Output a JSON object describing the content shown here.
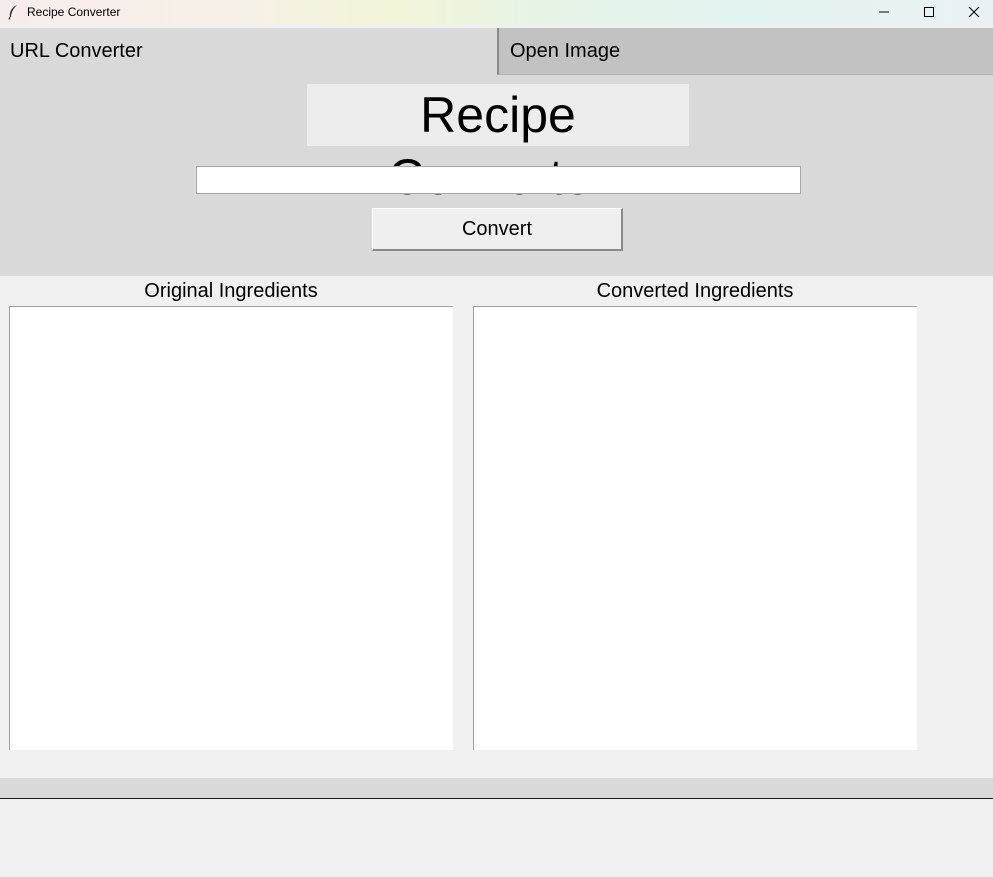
{
  "window": {
    "title": "Recipe Converter",
    "icon": "feather-icon",
    "controls": [
      "minimize-icon",
      "maximize-icon",
      "close-icon"
    ]
  },
  "tabs": [
    {
      "label": "URL Converter",
      "selected": true
    },
    {
      "label": "Open Image",
      "selected": false
    }
  ],
  "main": {
    "heading": "Recipe Converter",
    "url_input": {
      "value": "",
      "placeholder": ""
    },
    "convert_label": "Convert"
  },
  "panels": {
    "original": {
      "label": "Original Ingredients",
      "content": ""
    },
    "converted": {
      "label": "Converted Ingredients",
      "content": ""
    }
  },
  "colors": {
    "panel_bg": "#d9d9d9",
    "window_bg": "#f0f0f0",
    "inactive_tab": "#c2c2c2"
  }
}
